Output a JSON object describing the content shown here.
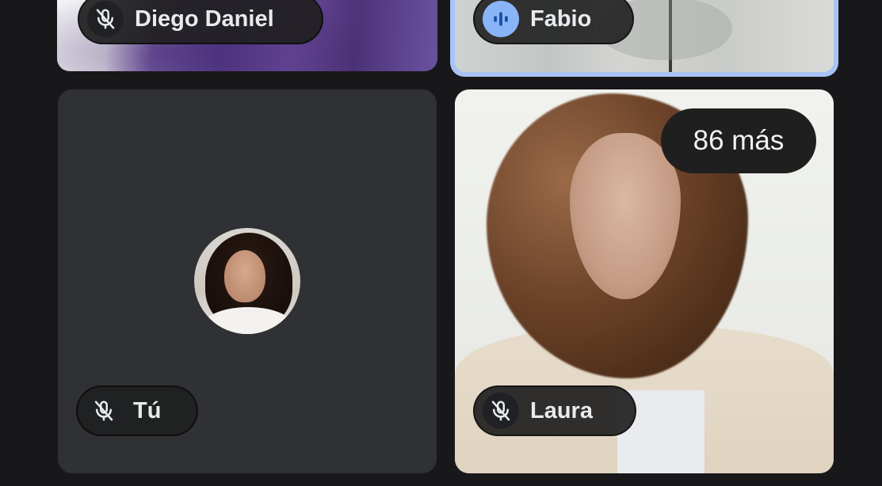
{
  "participants": [
    {
      "name": "Diego Daniel",
      "mic": "muted"
    },
    {
      "name": "Fabio",
      "mic": "speaking"
    },
    {
      "name": "Tú",
      "mic": "muted"
    },
    {
      "name": "Laura",
      "mic": "muted"
    }
  ],
  "overflow_badge": "86 más",
  "colors": {
    "background": "#18181a",
    "tile": "#303134",
    "active_speaker_border": "#a9c3f5",
    "speaking_indicator": "#8ab4f8",
    "pill": "#1f1f1f"
  },
  "icons": {
    "muted": "mic-off-icon",
    "speaking": "audio-level-icon"
  }
}
